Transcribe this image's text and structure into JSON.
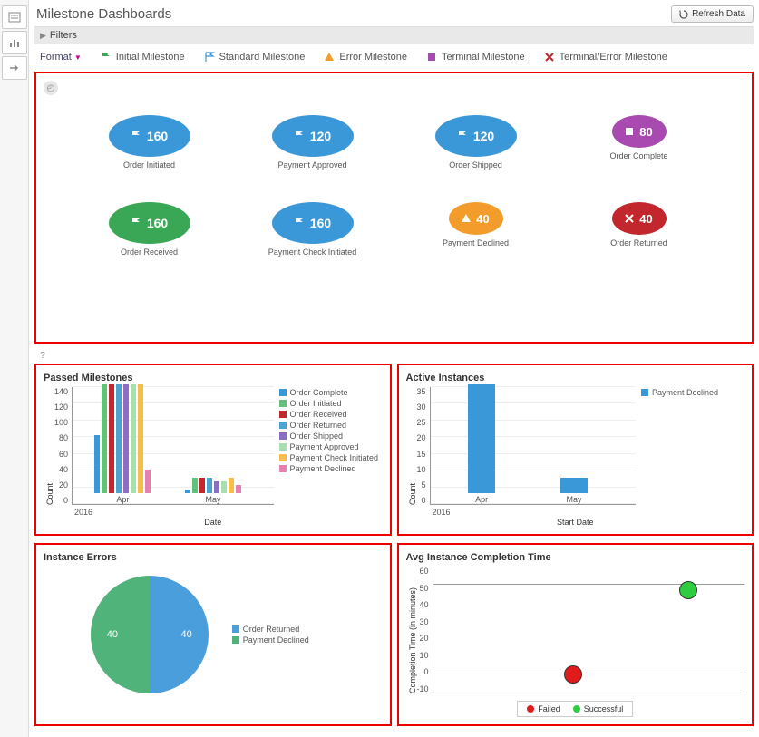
{
  "header": {
    "title": "Milestone Dashboards",
    "refresh_label": "Refresh Data",
    "filters_label": "Filters",
    "format_label": "Format"
  },
  "legend": {
    "initial": "Initial Milestone",
    "standard": "Standard Milestone",
    "error": "Error Milestone",
    "terminal": "Terminal Milestone",
    "terminal_error": "Terminal/Error Milestone"
  },
  "flow": {
    "row1": [
      {
        "label": "Order Initiated",
        "value": "160",
        "color": "#3b98d8",
        "icon": "flag",
        "size": "lg"
      },
      {
        "label": "Payment Approved",
        "value": "120",
        "color": "#3b98d8",
        "icon": "flag",
        "size": "lg"
      },
      {
        "label": "Order Shipped",
        "value": "120",
        "color": "#3b98d8",
        "icon": "flag",
        "size": "lg"
      },
      {
        "label": "Order Complete",
        "value": "80",
        "color": "#a94ab1",
        "icon": "stop",
        "size": "md"
      }
    ],
    "row2": [
      {
        "label": "Order Received",
        "value": "160",
        "color": "#3aa757",
        "icon": "flag-solid",
        "size": "lg"
      },
      {
        "label": "Payment Check Initiated",
        "value": "160",
        "color": "#3b98d8",
        "icon": "flag",
        "size": "lg"
      },
      {
        "label": "Payment Declined",
        "value": "40",
        "color": "#f39c2b",
        "icon": "warn",
        "size": "md"
      },
      {
        "label": "Order Returned",
        "value": "40",
        "color": "#c1272d",
        "icon": "x",
        "size": "md"
      }
    ]
  },
  "palette": {
    "order_complete": "#3b98d8",
    "order_initiated": "#62c17a",
    "order_received": "#c1272d",
    "order_returned": "#4aa3d0",
    "order_shipped": "#8b6fc4",
    "payment_approved": "#a9deb3",
    "payment_check_initiated": "#f4c04b",
    "payment_declined": "#e77fb0"
  },
  "chart_data": [
    {
      "id": "passed_milestones",
      "title": "Passed Milestones",
      "type": "bar",
      "xlabel": "Date",
      "ylabel": "Count",
      "year": "2016",
      "ylim": [
        0,
        140
      ],
      "yticks": [
        0,
        20,
        40,
        60,
        80,
        100,
        120,
        140
      ],
      "categories": [
        "Apr",
        "May"
      ],
      "series": [
        {
          "name": "Order Complete",
          "color_key": "order_complete",
          "values": [
            75,
            5
          ]
        },
        {
          "name": "Order Initiated",
          "color_key": "order_initiated",
          "values": [
            140,
            20
          ]
        },
        {
          "name": "Order Received",
          "color_key": "order_received",
          "values": [
            140,
            20
          ]
        },
        {
          "name": "Order Returned",
          "color_key": "order_returned",
          "values": [
            140,
            20
          ]
        },
        {
          "name": "Order Shipped",
          "color_key": "order_shipped",
          "values": [
            140,
            15
          ]
        },
        {
          "name": "Payment Approved",
          "color_key": "payment_approved",
          "values": [
            140,
            15
          ]
        },
        {
          "name": "Payment Check Initiated",
          "color_key": "payment_check_initiated",
          "values": [
            140,
            20
          ]
        },
        {
          "name": "Payment Declined",
          "color_key": "payment_declined",
          "values": [
            30,
            10
          ]
        }
      ]
    },
    {
      "id": "active_instances",
      "title": "Active Instances",
      "type": "bar",
      "xlabel": "Start Date",
      "ylabel": "Count",
      "year": "2016",
      "ylim": [
        0,
        35
      ],
      "yticks": [
        0,
        5,
        10,
        15,
        20,
        25,
        30,
        35
      ],
      "categories": [
        "Apr",
        "May"
      ],
      "series": [
        {
          "name": "Payment Declined",
          "color_key": "order_complete",
          "values": [
            35,
            5
          ]
        }
      ]
    },
    {
      "id": "instance_errors",
      "title": "Instance Errors",
      "type": "pie",
      "series": [
        {
          "name": "Order Returned",
          "value": 40,
          "color": "#4a9edc"
        },
        {
          "name": "Payment Declined",
          "value": 40,
          "color": "#4fb37a"
        }
      ]
    },
    {
      "id": "avg_completion",
      "title": "Avg Instance Completion Time",
      "type": "scatter",
      "ylabel": "Completion Time (in minutes)",
      "ylim": [
        -10,
        60
      ],
      "yticks": [
        -10,
        0,
        10,
        20,
        30,
        40,
        50,
        60
      ],
      "series": [
        {
          "name": "Failed",
          "color": "#e01b1b",
          "x": 0.45,
          "y": 0
        },
        {
          "name": "Successful",
          "color": "#2ecc40",
          "x": 0.82,
          "y": 47
        }
      ]
    }
  ]
}
